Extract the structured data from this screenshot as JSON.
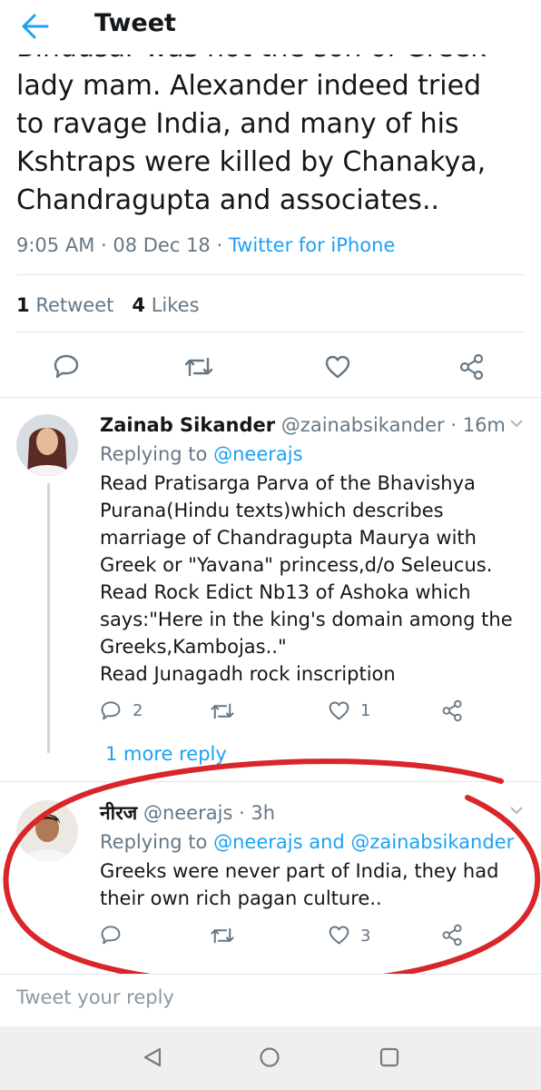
{
  "header": {
    "title": "Tweet",
    "back_icon": "arrow-left-icon",
    "accent": "#1da1f2"
  },
  "main_tweet": {
    "cut_line": "Bindusar was not the son of Greek",
    "lines": [
      "lady mam. Alexander indeed tried",
      "to ravage India, and many of his",
      "Kshtraps were killed by Chanakya,",
      "Chandragupta and associates.."
    ],
    "time": "9:05 AM",
    "date": "08 Dec 18",
    "source": "Twitter for iPhone",
    "retweets_count": "1",
    "retweets_label": "Retweet",
    "likes_count": "4",
    "likes_label": "Likes"
  },
  "replies": [
    {
      "name": "Zainab Sikander",
      "handle": "@zainabsikander",
      "time": "16m",
      "replying_label": "Replying to",
      "replying_to": "@neerajs",
      "lines": [
        "Read Pratisarga Parva of the Bhavishya",
        "Purana(Hindu texts)which describes",
        "marriage of Chandragupta Maurya with",
        "Greek or \"Yavana\" princess,d/o Seleucus.",
        "Read Rock Edict Nb13 of Ashoka which",
        "says:\"Here in the king's domain among the",
        "Greeks,Kambojas..\"",
        "Read Junagadh rock inscription"
      ],
      "reply_count": "2",
      "like_count": "1",
      "more_replies": "1 more reply"
    },
    {
      "name": "नीरज",
      "handle": "@neerajs",
      "time": "3h",
      "replying_label": "Replying to",
      "replying_to": "@neerajs and @zainabsikander",
      "lines": [
        "Greeks were never part of India, they had",
        "their own rich pagan culture.."
      ],
      "like_count": "3"
    }
  ],
  "compose": {
    "placeholder": "Tweet your reply"
  },
  "annotation_color": "#d9262a"
}
